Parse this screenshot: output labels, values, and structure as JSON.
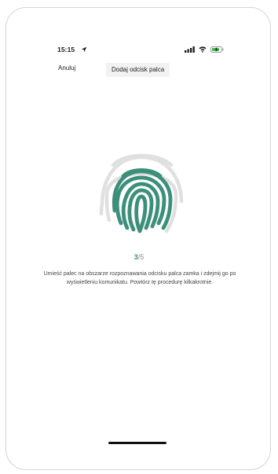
{
  "status_bar": {
    "time": "15:15",
    "icons": [
      "location-arrow-icon",
      "cellular-signal-icon",
      "wifi-icon",
      "battery-charging-icon"
    ]
  },
  "nav": {
    "cancel_label": "Anuluj",
    "title": "Dodaj odcisk palca"
  },
  "fingerprint": {
    "icon": "fingerprint-icon",
    "active_color": "#3c8f7b",
    "inactive_color": "#e0e0e0"
  },
  "progress": {
    "current": "3",
    "separator_total": "/5"
  },
  "instruction": "Umieść palec na obszarze rozpoznawania odcisku palca zamka i zdejmij go po wyświetleniu komunikatu. Powtórz tę procedurę kilkakrotnie."
}
